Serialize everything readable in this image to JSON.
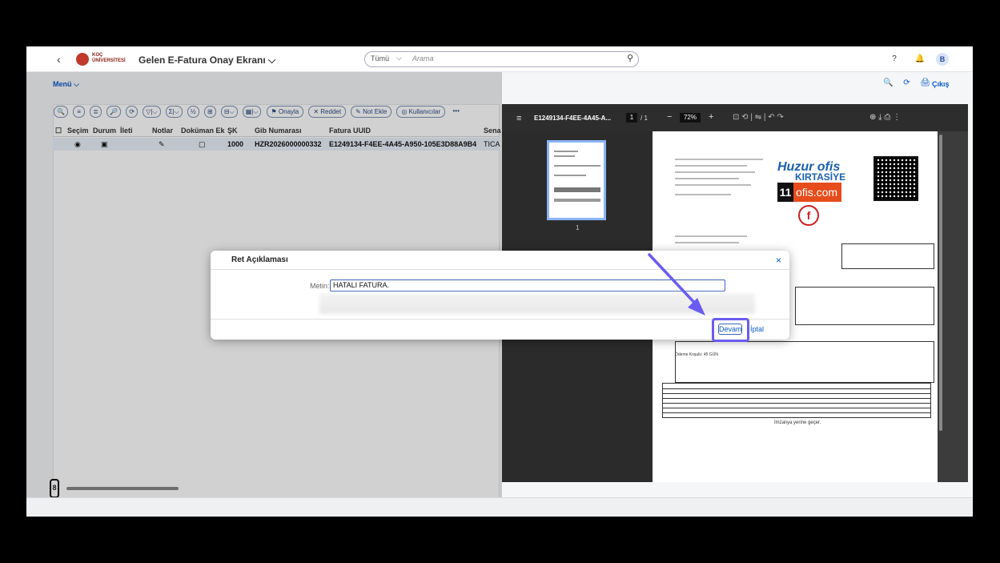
{
  "shellbar": {
    "back_label": "‹",
    "logo_text": "KOÇ ÜNİVERSİTESİ",
    "app_title": "Gelen E-Fatura Onay Ekranı ⌵",
    "search": {
      "scope": "Tümü",
      "scope_chevron": "⌵",
      "placeholder": "Arama",
      "icon": "search-icon",
      "icon_glyph": "⚲"
    },
    "help_glyph": "?",
    "bell_glyph": "🔔",
    "avatar_initial": "B"
  },
  "subbar": {
    "menu_label": "Menü ⌵",
    "icons": [
      "🔍",
      "⟳",
      "🖨"
    ],
    "logout_label": "Çıkış"
  },
  "toolbar": {
    "icon_buttons": [
      "🔍",
      "≡",
      "≣",
      "🔎",
      "⟳",
      "▽|⌵",
      "Σ|⌵",
      "½",
      "⊞",
      "⊟⌵",
      "▦|⌵"
    ],
    "approve_label": "Onayla",
    "reject_label": "Reddet",
    "note_label": "Not Ekle",
    "users_label": "Kullanıcılar",
    "more_label": "•••"
  },
  "grid": {
    "columns": [
      "Seçim",
      "Durum",
      "İleti",
      "Notlar",
      "Doküman Ek",
      "ŞK",
      "Gib Numarası",
      "Fatura UUID",
      "Sena"
    ],
    "row": {
      "secim": "◉",
      "durum": "▣",
      "ileti": "",
      "notlar": "✎",
      "dokuman": "▢",
      "sk": "1000",
      "gib": "HZR2026000000332",
      "uuid": "E1249134-F4EE-4A45-A950-105E3D88A9B4",
      "sena": "TICA"
    }
  },
  "pdf": {
    "menu_glyph": "≡",
    "file_name": "E1249134-F4EE-4A45-A...",
    "page": "1",
    "total": "/ 1",
    "minus": "−",
    "zoom": "72%",
    "plus": "+",
    "tools": "⊡  ⟲  |  ⇋  |  ↶  ↷",
    "right_tools": "⊕    ⤓    ⎙    ⋮",
    "thumb_label": "1",
    "brand1": "Huzur ofis",
    "brand2": "KIRTASİYE",
    "brand3": "ofis.com",
    "brand3_num": "11",
    "stamp": "f",
    "bank_title": "Ödeme Koşulu: 45 GÜN",
    "signature": "İmzalıya yerine geçer."
  },
  "dialog": {
    "title": "Ret Açıklaması",
    "close": "×",
    "label": "Metin:",
    "value": "HATALI FATURA.",
    "continue_label": "Devam",
    "cancel_label": "İptal"
  },
  "colors": {
    "accent": "#0a58ca",
    "highlight": "#6a5cf0"
  }
}
